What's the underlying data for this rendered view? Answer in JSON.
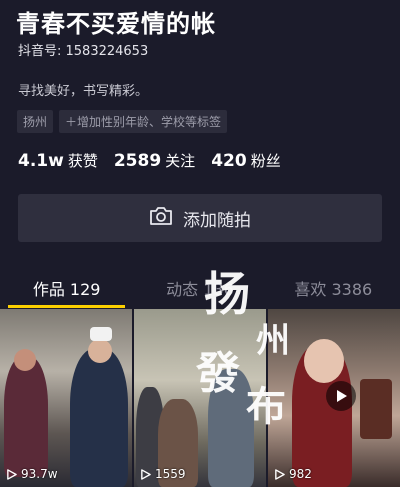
{
  "profile": {
    "nickname": "青春不买爱情的帐",
    "douyin_id": "抖音号: 1583224653",
    "bio": "寻找美好，书写精彩。",
    "tags": [
      "扬州",
      "＋增加性别年龄、学校等标签"
    ]
  },
  "stats": [
    {
      "num": "4.1w",
      "label": "获赞"
    },
    {
      "num": "2589",
      "label": "关注"
    },
    {
      "num": "420",
      "label": "粉丝"
    }
  ],
  "add_friend": {
    "label": "添加随拍",
    "icon": "camera-icon"
  },
  "tabs": [
    {
      "label": "作品 129",
      "active": true
    },
    {
      "label": "动态 136",
      "active": false
    },
    {
      "label": "喜欢 3386",
      "active": false
    }
  ],
  "videos": [
    {
      "plays": "93.7w"
    },
    {
      "plays": "1559"
    },
    {
      "plays": "982"
    }
  ],
  "watermark": {
    "text": "扬州發布"
  },
  "colors": {
    "background": "#1b1b2a",
    "accent": "#fcd000",
    "button": "#2f2f3e"
  }
}
